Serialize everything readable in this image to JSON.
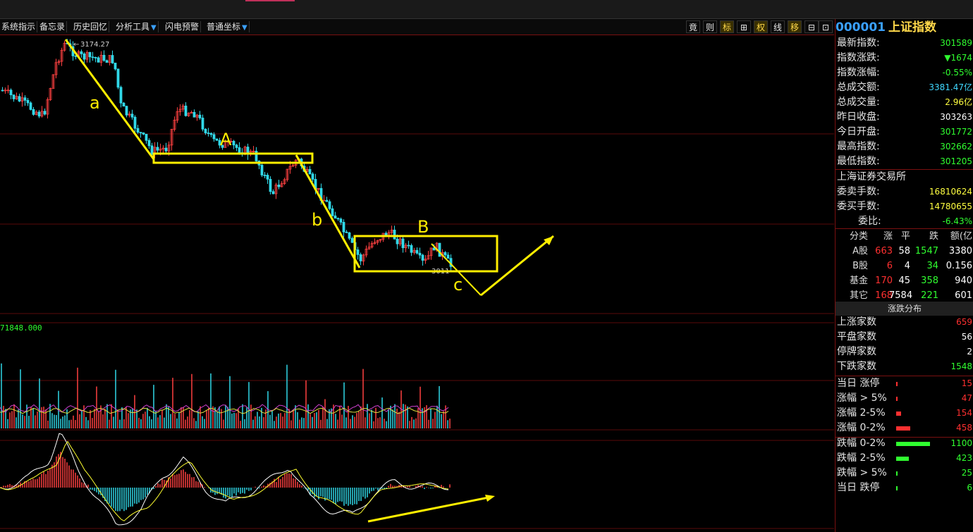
{
  "toolbar": {
    "items": [
      "系统指示",
      "备忘录",
      "历史回忆",
      "分析工具",
      "闪电预警",
      "普通坐标"
    ],
    "right_buttons": [
      "竟",
      "则",
      "标",
      "⊞",
      "权",
      "线",
      "移",
      "⊟",
      "⊡"
    ]
  },
  "chart": {
    "high_label": "3174.27",
    "low_label": "3011",
    "volume_label": "71848.000",
    "annotations": [
      "a",
      "A",
      "b",
      "B",
      "c"
    ]
  },
  "panel": {
    "code": "000001",
    "name": "上证指数",
    "rows": [
      {
        "label": "最新指数:",
        "value": "301589",
        "color": "#30ff30"
      },
      {
        "label": "指数涨跌:",
        "value": "▼1674",
        "color": "#30ff30"
      },
      {
        "label": "指数涨幅:",
        "value": "-0.55%",
        "color": "#30ff30"
      },
      {
        "label": "总成交额:",
        "value": "3381.47亿",
        "color": "#40d8ff"
      },
      {
        "label": "总成交量:",
        "value": "2.96亿",
        "color": "#ffff40"
      },
      {
        "label": "昨日收盘:",
        "value": "303263",
        "color": "#ffffff"
      },
      {
        "label": "今日开盘:",
        "value": "301772",
        "color": "#30ff30"
      },
      {
        "label": "最高指数:",
        "value": "302662",
        "color": "#30ff30"
      },
      {
        "label": "最低指数:",
        "value": "301205",
        "color": "#30ff30"
      }
    ],
    "exchange": "上海证券交易所",
    "rows2": [
      {
        "label": "委卖手数:",
        "value": "16810624",
        "color": "#ffff40"
      },
      {
        "label": "委买手数:",
        "value": "14780655",
        "color": "#ffff40"
      },
      {
        "label": "委比:",
        "value": "-6.43%",
        "color": "#30ff30"
      }
    ],
    "table_header": [
      "分类",
      "涨",
      "平",
      "跌",
      "额(亿"
    ],
    "table": [
      {
        "cat": "A股",
        "up": "663",
        "flat": "58",
        "down": "1547",
        "amt": "3380"
      },
      {
        "cat": "B股",
        "up": "6",
        "flat": "4",
        "down": "34",
        "amt": "0.156"
      },
      {
        "cat": "基金",
        "up": "170",
        "flat": "45",
        "down": "358",
        "amt": "940"
      },
      {
        "cat": "其它",
        "up": "168",
        "flat": "7584",
        "down": "221",
        "amt": "601"
      }
    ],
    "dist_title": "涨跌分布",
    "dist_counts": [
      {
        "label": "上涨家数",
        "value": "659",
        "color": "#ff3030"
      },
      {
        "label": "平盘家数",
        "value": "56",
        "color": "#ffffff"
      },
      {
        "label": "停牌家数",
        "value": "2",
        "color": "#ffffff"
      },
      {
        "label": "下跌家数",
        "value": "1548",
        "color": "#30ff30"
      }
    ],
    "dist_up": [
      {
        "label": "当日 涨停",
        "value": "15",
        "bar": 0.01
      },
      {
        "label": "涨幅 > 5%",
        "value": "47",
        "bar": 0.01
      },
      {
        "label": "涨幅 2-5%",
        "value": "154",
        "bar": 0.14
      },
      {
        "label": "涨幅 0-2%",
        "value": "458",
        "bar": 0.42
      }
    ],
    "dist_down": [
      {
        "label": "跌幅 0-2%",
        "value": "1100",
        "bar": 1.0
      },
      {
        "label": "跌幅 2-5%",
        "value": "423",
        "bar": 0.38
      },
      {
        "label": "跌幅 > 5%",
        "value": "25",
        "bar": 0.02
      },
      {
        "label": "当日 跌停",
        "value": "6",
        "bar": 0.01
      }
    ]
  }
}
